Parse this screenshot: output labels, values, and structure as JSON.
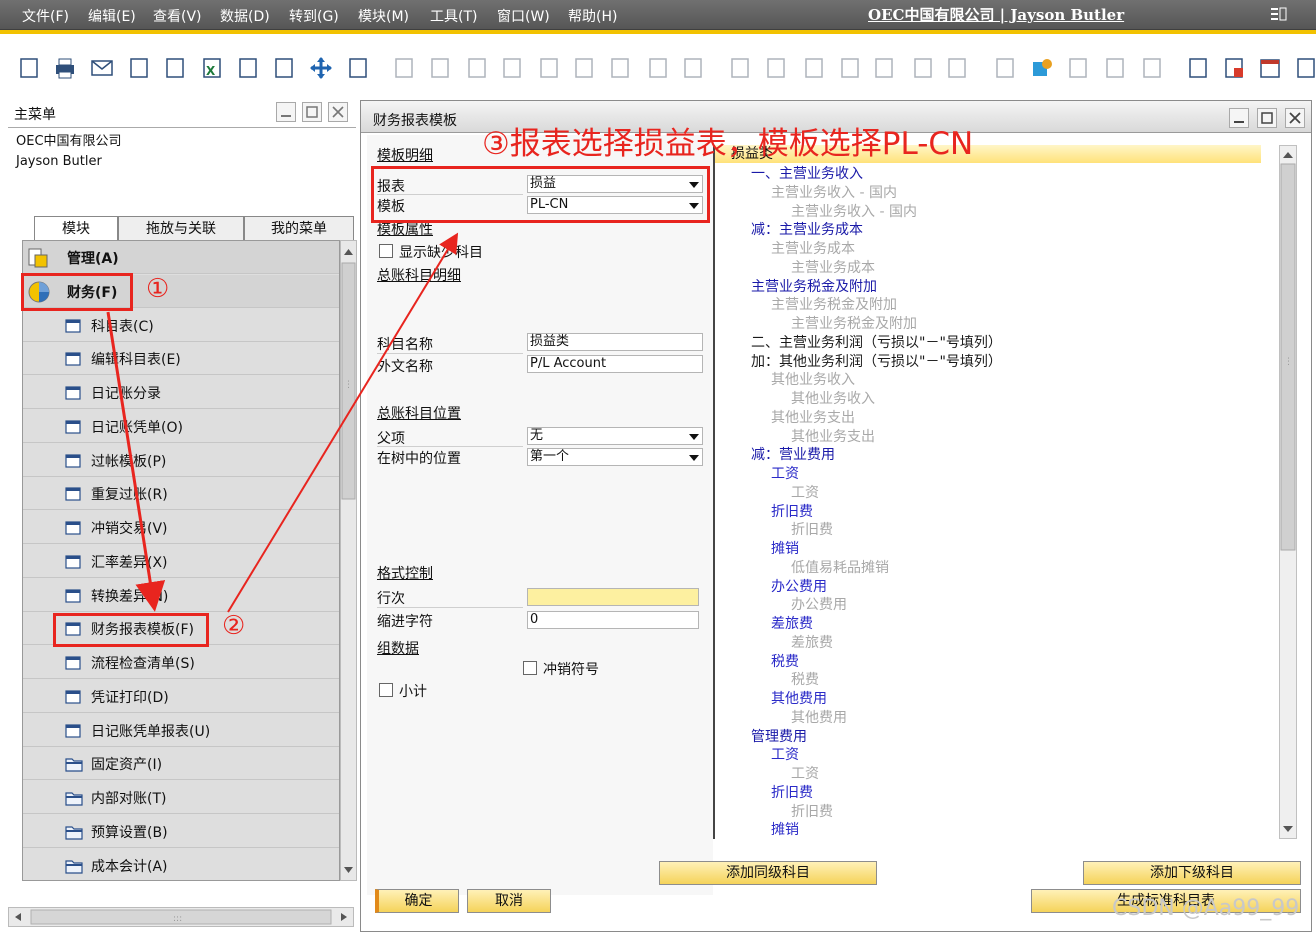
{
  "menubar": {
    "items": [
      "文件(F)",
      "编辑(E)",
      "查看(V)",
      "数据(D)",
      "转到(G)",
      "模块(M)",
      "工具(T)",
      "窗口(W)",
      "帮助(H)"
    ],
    "company_user": "OEC中国有限公司 | Jayson Butler"
  },
  "main_menu": {
    "title": "主菜单",
    "company": "OEC中国有限公司",
    "user": "Jayson Butler",
    "tabs": [
      "模块",
      "拖放与关联",
      "我的菜单"
    ],
    "items": [
      {
        "label": "管理(A)",
        "type": "module"
      },
      {
        "label": "财务(F)",
        "type": "module"
      },
      {
        "label": "科目表(C)",
        "type": "form"
      },
      {
        "label": "编辑科目表(E)",
        "type": "form"
      },
      {
        "label": "日记账分录",
        "type": "form"
      },
      {
        "label": "日记账凭单(O)",
        "type": "form"
      },
      {
        "label": "过帐模板(P)",
        "type": "form"
      },
      {
        "label": "重复过账(R)",
        "type": "form"
      },
      {
        "label": "冲销交易(V)",
        "type": "form"
      },
      {
        "label": "汇率差异(X)",
        "type": "form"
      },
      {
        "label": "转换差异(N)",
        "type": "form"
      },
      {
        "label": "财务报表模板(F)",
        "type": "form"
      },
      {
        "label": "流程检查清单(S)",
        "type": "form"
      },
      {
        "label": "凭证打印(D)",
        "type": "form"
      },
      {
        "label": "日记账凭单报表(U)",
        "type": "form"
      },
      {
        "label": "固定资产(I)",
        "type": "folder"
      },
      {
        "label": "内部对账(T)",
        "type": "folder"
      },
      {
        "label": "预算设置(B)",
        "type": "folder"
      },
      {
        "label": "成本会计(A)",
        "type": "folder"
      }
    ]
  },
  "dialog": {
    "title": "财务报表模板",
    "template_detail": "模板明细",
    "report_label": "报表",
    "report_value": "损益",
    "template_label": "模板",
    "template_value": "PL-CN",
    "template_props": "模板属性",
    "show_missing": "显示缺少科目",
    "gl_detail": "总账科目明细",
    "acct_name_label": "科目名称",
    "acct_name_value": "损益类",
    "foreign_name_label": "外文名称",
    "foreign_name_value": "P/L Account",
    "gl_position": "总账科目位置",
    "parent_label": "父项",
    "parent_value": "无",
    "tree_pos_label": "在树中的位置",
    "tree_pos_value": "第一个",
    "format_control": "格式控制",
    "line_label": "行次",
    "line_value": "",
    "indent_label": "缩进字符",
    "indent_value": "0",
    "group_data": "组数据",
    "reverse_sign": "冲销符号",
    "subtotal": "小计",
    "btn_add_same": "添加同级科目",
    "btn_add_sub": "添加下级科目",
    "btn_ok": "确定",
    "btn_cancel": "取消",
    "btn_gen": "生成标准科目表"
  },
  "tree": {
    "header": "损益类",
    "items": [
      {
        "t": "一、主营业务收入",
        "l": 0
      },
      {
        "t": "主营业务收入 - 国内",
        "l": 2
      },
      {
        "t": "主营业务收入 - 国内",
        "l": 3
      },
      {
        "t": "减：主营业务成本",
        "l": 0
      },
      {
        "t": "主营业务成本",
        "l": 2
      },
      {
        "t": "主营业务成本",
        "l": 3
      },
      {
        "t": "主营业务税金及附加",
        "l": 0
      },
      {
        "t": "主营业务税金及附加",
        "l": 2
      },
      {
        "t": "主营业务税金及附加",
        "l": 3
      },
      {
        "t": "二、主营业务利润（亏损以\"－\"号填列）",
        "l": 9
      },
      {
        "t": "加：其他业务利润（亏损以\"－\"号填列）",
        "l": 9
      },
      {
        "t": "其他业务收入",
        "l": 2
      },
      {
        "t": "其他业务收入",
        "l": 3
      },
      {
        "t": "其他业务支出",
        "l": 2
      },
      {
        "t": "其他业务支出",
        "l": 3
      },
      {
        "t": "减：营业费用",
        "l": 0
      },
      {
        "t": "工资",
        "l": 1
      },
      {
        "t": "工资",
        "l": 3
      },
      {
        "t": "折旧费",
        "l": 1
      },
      {
        "t": "折旧费",
        "l": 3
      },
      {
        "t": "摊销",
        "l": 1
      },
      {
        "t": "低值易耗品摊销",
        "l": 3
      },
      {
        "t": "办公费用",
        "l": 1
      },
      {
        "t": "办公费用",
        "l": 3
      },
      {
        "t": "差旅费",
        "l": 1
      },
      {
        "t": "差旅费",
        "l": 3
      },
      {
        "t": "税费",
        "l": 1
      },
      {
        "t": "税费",
        "l": 3
      },
      {
        "t": "其他费用",
        "l": 1
      },
      {
        "t": "其他费用",
        "l": 3
      },
      {
        "t": "管理费用",
        "l": 0
      },
      {
        "t": "工资",
        "l": 1
      },
      {
        "t": "工资",
        "l": 3
      },
      {
        "t": "折旧费",
        "l": 1
      },
      {
        "t": "折旧费",
        "l": 3
      },
      {
        "t": "摊销",
        "l": 1
      }
    ]
  },
  "annotations": {
    "step1": "①",
    "step2": "②",
    "step3_text": "③报表选择损益表，模板选择PL-CN",
    "watermark": "CSDN @Aa99_99"
  },
  "colors": {
    "annotation": "#e8251f",
    "tree_level0": "#1a1aa8",
    "tree_level1": "#2a2ac8",
    "tree_level2": "#a8a8a8",
    "button": "#f5d35a",
    "toolbar_accent": "#f2c200"
  }
}
